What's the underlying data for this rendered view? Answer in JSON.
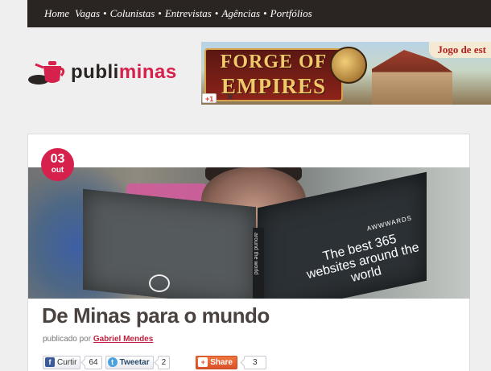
{
  "nav": {
    "items": [
      {
        "label": "Home"
      },
      {
        "label": "Vagas"
      },
      {
        "label": "Colunistas"
      },
      {
        "label": "Entrevistas"
      },
      {
        "label": "Agências"
      },
      {
        "label": "Portfólios"
      }
    ],
    "separator": "•"
  },
  "logo": {
    "part1": "publi",
    "part2": "minas",
    "icon": "teapot-drop-icon",
    "colors": {
      "dark": "#2a2523",
      "accent": "#d6214c"
    }
  },
  "ad": {
    "title_line1": "FORGE OF",
    "title_line2": "EMPIRES",
    "cta": "Jogo de est",
    "gplus": "+1",
    "close": "✕"
  },
  "post": {
    "date": {
      "day": "03",
      "month": "out"
    },
    "hero_book": {
      "headline": "The best 365 websites around the world",
      "brand": "AWWWARDS",
      "spine": "around the world"
    },
    "title": "De Minas para o mundo",
    "byline_prefix": "publicado por",
    "author": "Gabriel Mendes",
    "social": {
      "facebook_label": "Curtir",
      "facebook_count": "64",
      "twitter_label": "Tweetar",
      "twitter_count": "2",
      "share_label": "Share",
      "share_count": "3"
    }
  },
  "colors": {
    "accent": "#d6214c",
    "nav_bg": "#2a2523",
    "page_bg": "#efefef"
  }
}
